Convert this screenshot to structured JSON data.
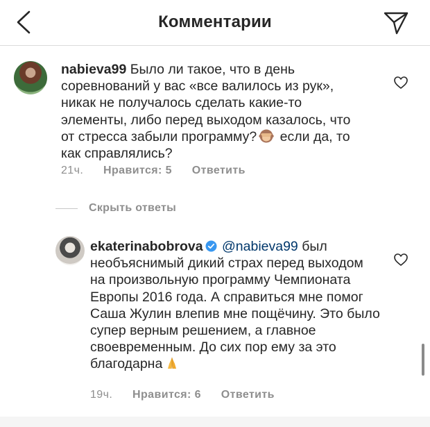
{
  "header": {
    "title": "Комментарии",
    "back_icon": "chevron-left-icon",
    "share_icon": "paper-plane-icon"
  },
  "comments": [
    {
      "username": "nabieva99",
      "text_before_emoji": "Было ли такое, что в день соревнований у вас «все валилось из рук», никак не получалось сделать какие-то элементы, либо перед выходом казалось, что от стресса забыли программу?",
      "emoji": "see-no-evil-monkey",
      "text_after_emoji": "если да, то как справлялись?",
      "time": "21ч.",
      "likes": "Нравится: 5",
      "reply": "Ответить"
    },
    {
      "username": "ekaterinabobrova",
      "verified": true,
      "mention": "@nabieva99",
      "text": "был необъяснимый дикий страх перед выходом на произвольную программу Чемпионата Европы 2016 года. А справиться мне помог Саша Жулин влепив мне пощёчину. Это было супер верным решением, а главное своевременным. До сих пор ему за это благодарна",
      "emoji": "folded-hands",
      "time": "19ч.",
      "likes": "Нравится: 6",
      "reply": "Ответить"
    }
  ],
  "hide_replies": "Скрыть ответы",
  "colors": {
    "text": "#262626",
    "meta": "#8e8e8e",
    "mention": "#00376b",
    "verified": "#3897f0"
  }
}
